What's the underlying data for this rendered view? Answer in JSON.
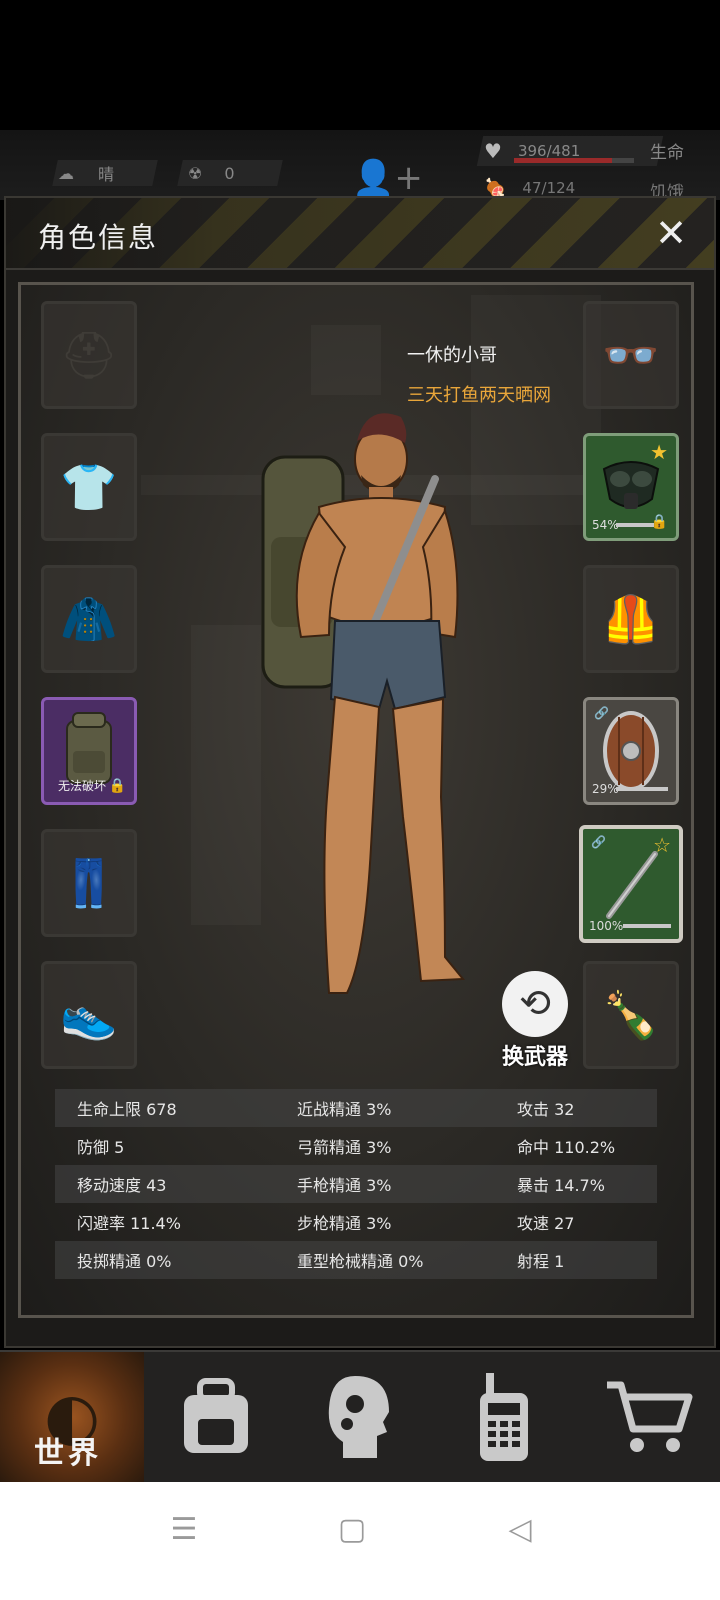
{
  "status_bar": {
    "weather": "晴",
    "radiation": "0",
    "hp": {
      "value": "396/481",
      "label": "生命",
      "fraction": 0.82
    },
    "hunger": {
      "value": "47/124",
      "label": "饥饿"
    }
  },
  "panel": {
    "title": "角色信息",
    "character": {
      "name": "一休的小哥",
      "title": "三天打鱼两天晒网"
    }
  },
  "left_slots": [
    {
      "name": "helmet",
      "icon": "helmet-icon",
      "glyph": "⛑"
    },
    {
      "name": "shirt",
      "icon": "shirt-icon",
      "glyph": "👕"
    },
    {
      "name": "coat",
      "icon": "coat-icon",
      "glyph": "🧥"
    },
    {
      "name": "backpack",
      "icon": "backpack-icon",
      "label": "无法破坏"
    },
    {
      "name": "pants",
      "icon": "pants-icon",
      "glyph": "👖"
    },
    {
      "name": "shoes",
      "icon": "shoes-icon",
      "glyph": "👟"
    }
  ],
  "right_slots": [
    {
      "name": "glasses",
      "icon": "glasses-icon",
      "glyph": "👓"
    },
    {
      "name": "gas-mask",
      "icon": "gas-mask-icon",
      "durability": "54%"
    },
    {
      "name": "vest",
      "icon": "vest-icon",
      "glyph": "🦺"
    },
    {
      "name": "shield",
      "icon": "shield-icon",
      "durability": "29%"
    },
    {
      "name": "pipe-weapon",
      "icon": "pipe-icon",
      "durability": "100%"
    },
    {
      "name": "throwable",
      "icon": "bottle-icon",
      "glyph": "🍾"
    }
  ],
  "swap_weapon": {
    "label": "换武器"
  },
  "stats": [
    [
      "生命上限 678",
      "近战精通 3%",
      "攻击 32"
    ],
    [
      "防御 5",
      "弓箭精通 3%",
      "命中 110.2%"
    ],
    [
      "移动速度 43",
      "手枪精通 3%",
      "暴击 14.7%"
    ],
    [
      "闪避率 11.4%",
      "步枪精通 3%",
      "攻速 27"
    ],
    [
      "投掷精通 0%",
      "重型枪械精通 0%",
      "射程 1"
    ]
  ],
  "bottom_nav": {
    "world": "世界"
  }
}
